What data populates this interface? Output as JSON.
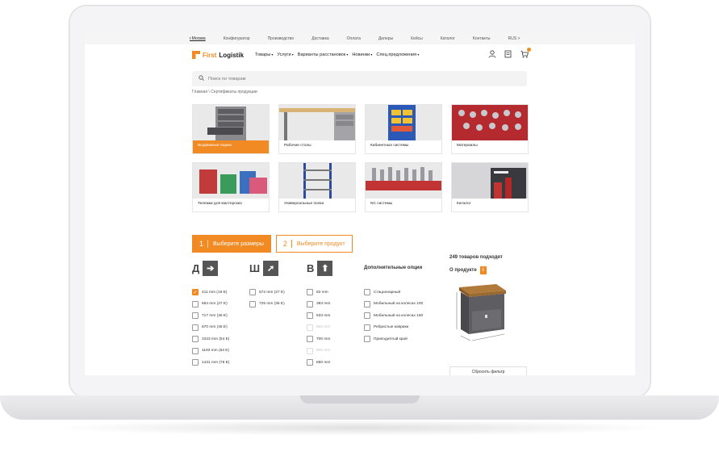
{
  "topbar": {
    "items": [
      "г.Москва",
      "Конфигуратор",
      "Производство",
      "Доставка",
      "Оплата",
      "Дилеры",
      "Кейсы",
      "Каталог",
      "Контакты",
      "RUS >"
    ]
  },
  "header": {
    "logo_first": "First",
    "logo_rest": "Logistik",
    "nav": [
      "Товары",
      "Услуги",
      "Варианты расстановок",
      "Новинки",
      "Спец.предложения"
    ]
  },
  "search": {
    "placeholder": "Поиск по товарам"
  },
  "breadcrumb": "Главная \\ Сертификаты продукции",
  "categories": [
    {
      "label": "Выдвижные ящики",
      "active": true
    },
    {
      "label": "Рабочие столы"
    },
    {
      "label": "Кабинетные системы"
    },
    {
      "label": "Материалы"
    },
    {
      "label": "Тележки для мастерских"
    },
    {
      "label": "Универсальные полки"
    },
    {
      "label": "NC системы"
    },
    {
      "label": "Каталог"
    }
  ],
  "steps": [
    {
      "num": "1",
      "label": "Выберите размеры"
    },
    {
      "num": "2",
      "label": "Выберите продукт"
    }
  ],
  "dims": {
    "d": {
      "letter": "Д",
      "arrow": "➔"
    },
    "w": {
      "letter": "Ш",
      "arrow": "➚"
    },
    "h": {
      "letter": "В",
      "arrow": "⬆"
    }
  },
  "depth_options": [
    "411 mm (18 E)",
    "564 mm (27 E)",
    "717 mm (36 E)",
    "870 mm (45 E)",
    "1023 mm (54 E)",
    "1193 mm (64 E)",
    "1431 mm (78 E)"
  ],
  "width_options": [
    "572 mm (27 E)",
    "725 mm (36 E)"
  ],
  "height_options": [
    "83 mm",
    "383 mm",
    "533 mm",
    "650 mm",
    "700 mm",
    "800 mm",
    "850 mm"
  ],
  "extra": {
    "title": "Дополнительные опции",
    "options": [
      "Стационарный",
      "Мобильный на колесах 100",
      "Мобильный на колесах 160",
      "Ребристые коврики",
      "Приподнятый край"
    ]
  },
  "summary": {
    "found": "249 товаров подходят",
    "about": "О продукте",
    "badge": "i",
    "reset": "Сбросить фильтр"
  },
  "colors": {
    "accent": "#f28a24"
  }
}
